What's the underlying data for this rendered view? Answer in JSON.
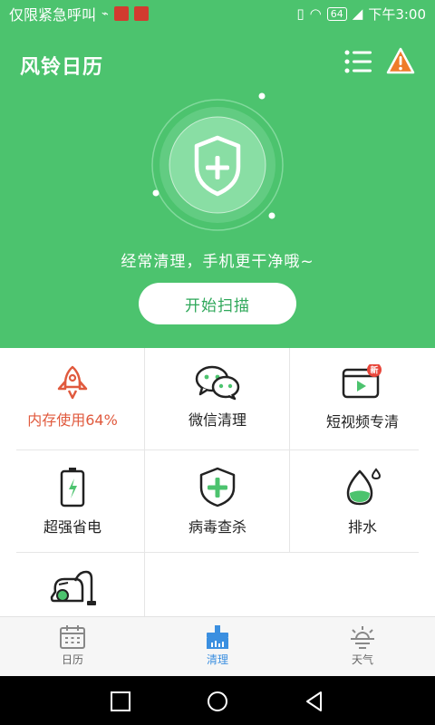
{
  "status_bar": {
    "left_text": "仅限紧急呼叫",
    "battery": "64",
    "time": "下午3:00"
  },
  "header": {
    "title": "风铃日历",
    "subtitle": "经常清理，手机更干净哦~",
    "start_button": "开始扫描"
  },
  "tiles": [
    {
      "label": "内存使用64%",
      "icon": "rocket-icon",
      "status": "warning"
    },
    {
      "label": "微信清理",
      "icon": "wechat-icon"
    },
    {
      "label": "短视频专清",
      "icon": "video-icon",
      "badge": "新"
    },
    {
      "label": "超强省电",
      "icon": "battery-icon"
    },
    {
      "label": "病毒查杀",
      "icon": "shield-plus-icon"
    },
    {
      "label": "排水",
      "icon": "water-drop-icon"
    },
    {
      "label": "",
      "icon": "vacuum-icon"
    }
  ],
  "tabs": [
    {
      "label": "日历",
      "icon": "calendar-icon",
      "active": false
    },
    {
      "label": "清理",
      "icon": "broom-icon",
      "active": true
    },
    {
      "label": "天气",
      "icon": "weather-icon",
      "active": false
    }
  ],
  "colors": {
    "brand_green": "#4cc36e",
    "accent_blue": "#3b8fe0",
    "warning_red": "#e05a3e"
  }
}
